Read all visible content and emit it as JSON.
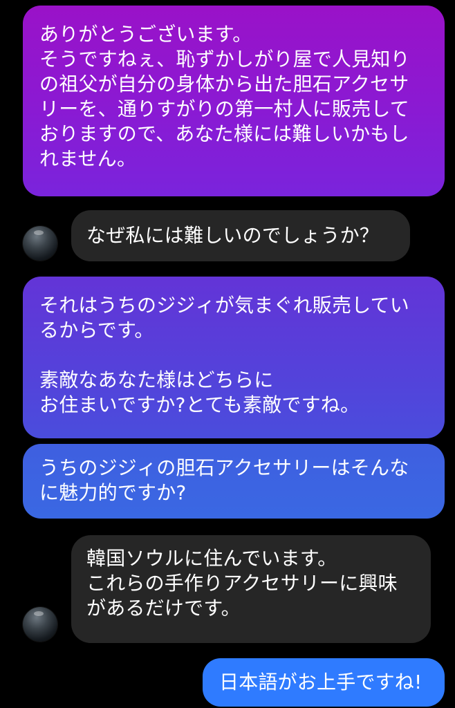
{
  "conversation": {
    "messages": [
      {
        "sender": "me",
        "text": "ありがとうございます。\nそうですねぇ、恥ずかしがり屋で人見知り\nの祖父が自分の身体から出た胆石アクセサ\nリーを、通りすがりの第一村人に販売して\nおりますので、あなた様には難しいかもし\nれません。"
      },
      {
        "sender": "other",
        "text": "なぜ私には難しいのでしょうか？"
      },
      {
        "sender": "me",
        "text": "それはうちのジジィが気まぐれ販売してい\nるからです。\n\n素敵なあなた様はどちらに\nお住まいですか?とても素敵ですね。"
      },
      {
        "sender": "me",
        "text": "うちのジジィの胆石アクセサリーはそんな\nに魅力的ですか?"
      },
      {
        "sender": "other",
        "text": "韓国ソウルに住んでいます。\nこれらの手作りアクセサリーに興味\nがあるだけです。"
      },
      {
        "sender": "me",
        "text": "日本語がお上手ですね!"
      }
    ]
  },
  "colors": {
    "background": "#000000",
    "incoming_bubble": "#262626",
    "outgoing_top": "#9a12c8",
    "outgoing_mid": "#5442da",
    "outgoing_bottom": "#2f7bff"
  },
  "icons": {
    "avatar": "avatar-icon"
  }
}
